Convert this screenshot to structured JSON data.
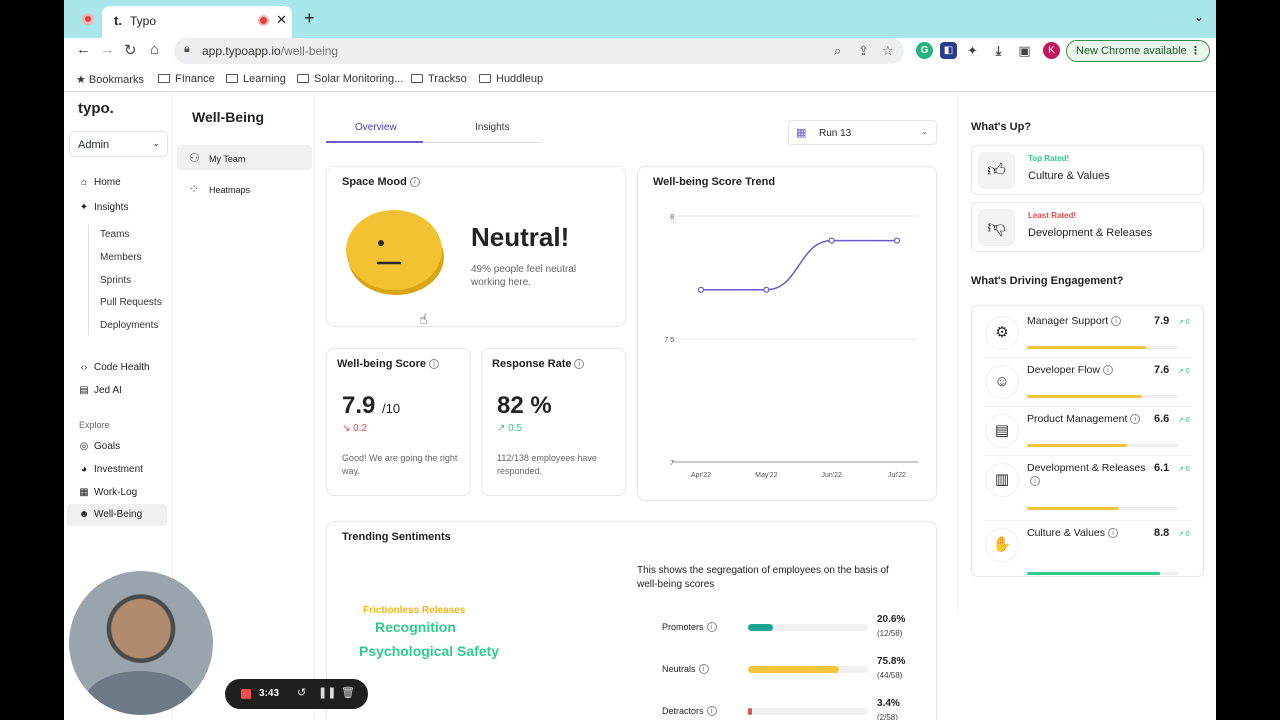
{
  "browser": {
    "tab_title": "Typo",
    "tab_favicon": "t.",
    "url_host": "app.typoapp.io",
    "url_path": "/well-being",
    "chrome_available": "New Chrome available",
    "profile_initial": "K",
    "bookmarks": [
      "Bookmarks",
      "FInance",
      "Learning",
      "Solar Monitoring...",
      "Trackso",
      "Huddleup"
    ]
  },
  "app": {
    "logo": "typo.",
    "role_select": "Admin",
    "nav": {
      "home": "Home",
      "insights": "Insights",
      "insights_children": [
        "Teams",
        "Members",
        "Sprints",
        "Pull Requests",
        "Deployments"
      ],
      "code_health": "Code Health",
      "jed_ai": "Jed AI",
      "explore_label": "Explore",
      "goals": "Goals",
      "investment": "Investment",
      "work_log": "Work-Log",
      "well_being": "Well-Being"
    },
    "subnav": {
      "title": "Well-Being",
      "my_team": "My Team",
      "heatmaps": "Heatmaps"
    }
  },
  "main": {
    "tabs": [
      "Overview",
      "Insights"
    ],
    "run_select": "Run 13",
    "space_mood": {
      "title": "Space Mood",
      "label": "Neutral!",
      "description": "49% people feel neutral working here."
    },
    "wellbeing_score": {
      "title": "Well-being Score",
      "value": "7.9",
      "denominator": "/10",
      "delta": "↘ 0.2",
      "note": "Good! We are going the right way."
    },
    "response_rate": {
      "title": "Response Rate",
      "value": "82 %",
      "delta": "↗ 0.5",
      "note": "112/138 employees have responded."
    },
    "trend": {
      "title": "Well-being Score Trend"
    },
    "sentiments": {
      "title": "Trending Sentiments",
      "words": [
        "Frictionless Releases",
        "Recognition",
        "Psychological Safety"
      ],
      "description": "This shows the segregation of employees on the basis of well-being scores",
      "segments": [
        {
          "label": "Promoters",
          "pct": "20.6%",
          "count": "(12/58)",
          "value": 0.206,
          "color": "#1aa594"
        },
        {
          "label": "Neutrals",
          "pct": "75.8%",
          "count": "(44/58)",
          "value": 0.758,
          "color": "#f2c53d"
        },
        {
          "label": "Detractors",
          "pct": "3.4%",
          "count": "(2/58)",
          "value": 0.034,
          "color": "#e94b4b"
        }
      ]
    }
  },
  "right": {
    "whats_up": "What's Up?",
    "top_rated_tag": "Top Rated!",
    "top_rated": "Culture & Values",
    "least_rated_tag": "Least Rated!",
    "least_rated": "Development & Releases",
    "driving_title": "What's Driving Engagement?",
    "drivers": [
      {
        "name": "Manager Support",
        "score": "7.9",
        "change": "↗ 0",
        "value": 7.9,
        "color": "#f2c53d"
      },
      {
        "name": "Developer Flow",
        "score": "7.6",
        "change": "↗ 0",
        "value": 7.6,
        "color": "#f2c53d"
      },
      {
        "name": "Product Management",
        "score": "6.6",
        "change": "↗ 0",
        "value": 6.6,
        "color": "#f2c53d"
      },
      {
        "name": "Development & Releases",
        "score": "6.1",
        "change": "↗ 0",
        "value": 6.1,
        "color": "#f2c53d"
      },
      {
        "name": "Culture & Values",
        "score": "8.8",
        "change": "↗ 0",
        "value": 8.8,
        "color": "#2ecc8a"
      }
    ]
  },
  "recorder": {
    "time": "3:43"
  },
  "chart_data": {
    "type": "line",
    "title": "Well-being Score Trend",
    "x": [
      "Apr'22",
      "May'22",
      "Jun'22",
      "Jul'22"
    ],
    "series": [
      {
        "values": [
          7.7,
          7.7,
          7.9,
          7.9
        ]
      }
    ],
    "yticks": [
      "8",
      "7.5",
      "7"
    ],
    "ylim": [
      7,
      8
    ],
    "color": "#6a5acd",
    "grid": true
  }
}
